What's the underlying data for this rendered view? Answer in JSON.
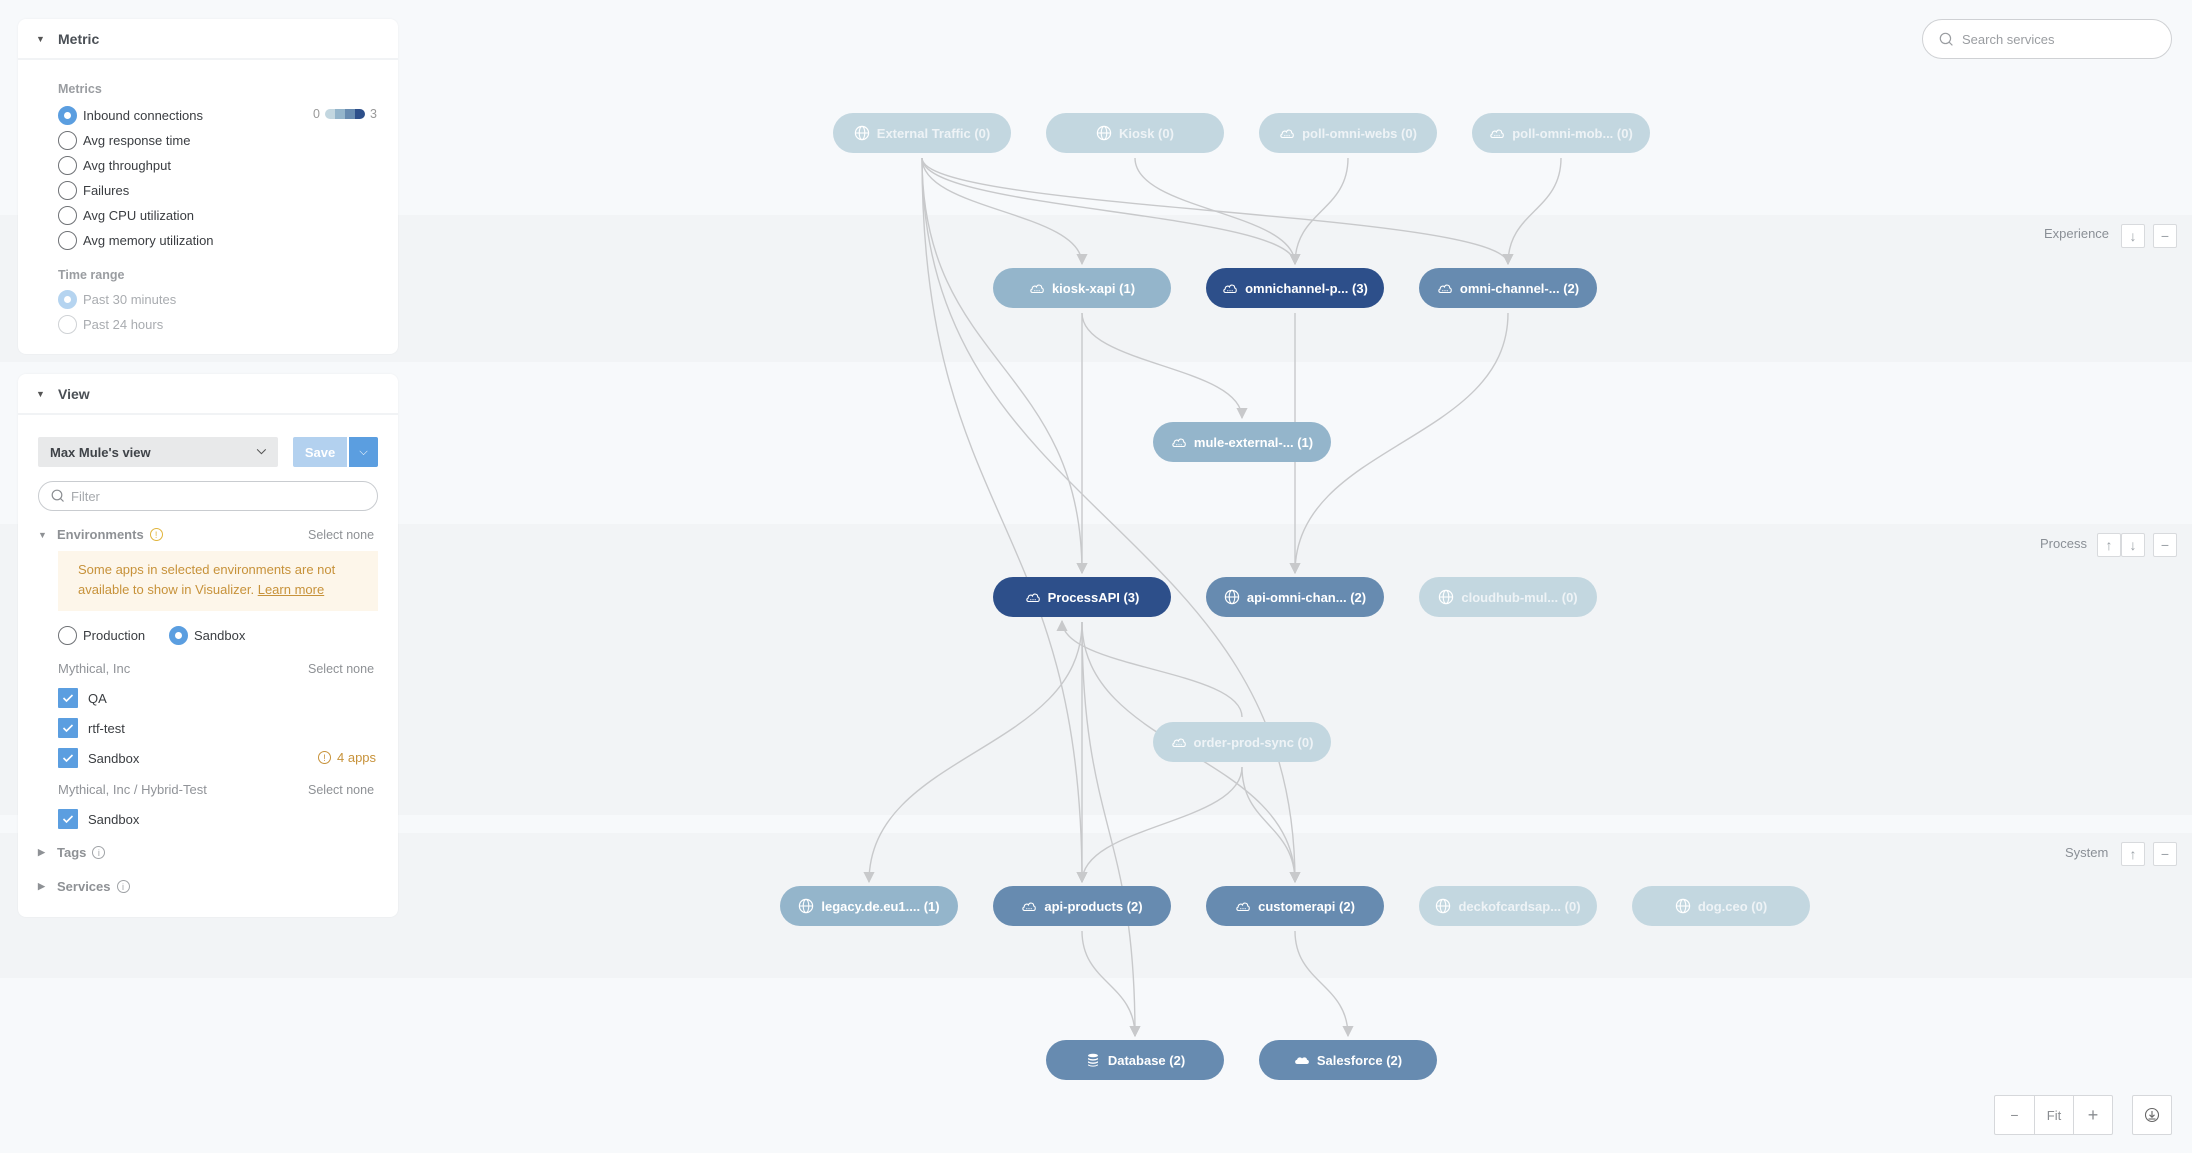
{
  "search": {
    "placeholder": "Search services"
  },
  "metric_panel": {
    "title": "Metric",
    "metrics_label": "Metrics",
    "metrics": [
      {
        "label": "Inbound connections",
        "selected": true
      },
      {
        "label": "Avg response time",
        "selected": false
      },
      {
        "label": "Avg throughput",
        "selected": false
      },
      {
        "label": "Failures",
        "selected": false
      },
      {
        "label": "Avg CPU utilization",
        "selected": false
      },
      {
        "label": "Avg memory utilization",
        "selected": false
      }
    ],
    "scale": {
      "min": "0",
      "max": "3",
      "colors": [
        "#c3d7e0",
        "#94b5cb",
        "#678bb0",
        "#2d4f8a"
      ]
    },
    "time_range_label": "Time range",
    "time_ranges": [
      {
        "label": "Past 30 minutes",
        "selected": true,
        "disabled": true
      },
      {
        "label": "Past 24 hours",
        "selected": false,
        "disabled": true
      }
    ]
  },
  "view_panel": {
    "title": "View",
    "selected_view": "Max Mule's view",
    "save_label": "Save",
    "filter_placeholder": "Filter",
    "environments": {
      "label": "Environments",
      "select_none": "Select none",
      "warning_text": "Some apps in selected environments are not available to show in Visualizer.",
      "learn_more": "Learn more",
      "types": [
        {
          "label": "Production",
          "selected": false
        },
        {
          "label": "Sandbox",
          "selected": true
        }
      ],
      "groups": [
        {
          "name": "Mythical, Inc",
          "select_none": "Select none",
          "items": [
            {
              "label": "QA",
              "checked": true
            },
            {
              "label": "rtf-test",
              "checked": true
            },
            {
              "label": "Sandbox",
              "checked": true,
              "warning": "4 apps"
            }
          ]
        },
        {
          "name": "Mythical, Inc / Hybrid-Test",
          "select_none": "Select none",
          "items": [
            {
              "label": "Sandbox",
              "checked": true
            }
          ]
        }
      ]
    },
    "tags_label": "Tags",
    "services_label": "Services"
  },
  "layers": [
    {
      "label": "Experience"
    },
    {
      "label": "Process"
    },
    {
      "label": "System"
    }
  ],
  "graph": {
    "nodes": [
      {
        "id": "ext",
        "label": "External Traffic (0)",
        "icon": "globe-icon",
        "level": 0
      },
      {
        "id": "kiosk",
        "label": "Kiosk (0)",
        "icon": "globe-icon",
        "level": 0
      },
      {
        "id": "pollweb",
        "label": "poll-omni-webs (0)",
        "icon": "cloud-icon",
        "level": 0
      },
      {
        "id": "pollmob",
        "label": "poll-omni-mob... (0)",
        "icon": "cloud-icon",
        "level": 0
      },
      {
        "id": "kxapi",
        "label": "kiosk-xapi (1)",
        "icon": "cloud-icon",
        "level": 1
      },
      {
        "id": "omnip",
        "label": "omnichannel-p... (3)",
        "icon": "cloud-icon",
        "level": 3
      },
      {
        "id": "omnic",
        "label": "omni-channel-... (2)",
        "icon": "cloud-icon",
        "level": 2
      },
      {
        "id": "mulext",
        "label": "mule-external-... (1)",
        "icon": "cloud-icon",
        "level": 1
      },
      {
        "id": "papi",
        "label": "ProcessAPI (3)",
        "icon": "cloud-icon",
        "level": 3
      },
      {
        "id": "apiomni",
        "label": "api-omni-chan... (2)",
        "icon": "globe-icon",
        "level": 2
      },
      {
        "id": "cloudhub",
        "label": "cloudhub-mul... (0)",
        "icon": "globe-icon",
        "level": 0
      },
      {
        "id": "ops",
        "label": "order-prod-sync (0)",
        "icon": "cloud-icon",
        "level": 0
      },
      {
        "id": "legacy",
        "label": "legacy.de.eu1.... (1)",
        "icon": "globe-icon",
        "level": 1
      },
      {
        "id": "apiprod",
        "label": "api-products (2)",
        "icon": "cloud-icon",
        "level": 2
      },
      {
        "id": "custapi",
        "label": "customerapi (2)",
        "icon": "cloud-icon",
        "level": 2
      },
      {
        "id": "deck",
        "label": "deckofcardsap... (0)",
        "icon": "globe-icon",
        "level": 0
      },
      {
        "id": "dog",
        "label": "dog.ceo (0)",
        "icon": "globe-icon",
        "level": 0
      },
      {
        "id": "db",
        "label": "Database (2)",
        "icon": "database-icon",
        "level": 2
      },
      {
        "id": "sf",
        "label": "Salesforce (2)",
        "icon": "salesforce-icon",
        "level": 2
      }
    ],
    "edges": [
      {
        "from": "ext",
        "to": "kxapi"
      },
      {
        "from": "ext",
        "to": "omnip"
      },
      {
        "from": "ext",
        "to": "omnic"
      },
      {
        "from": "ext",
        "to": "papi"
      },
      {
        "from": "ext",
        "to": "apiprod"
      },
      {
        "from": "ext",
        "to": "custapi"
      },
      {
        "from": "kiosk",
        "to": "omnip"
      },
      {
        "from": "pollweb",
        "to": "omnip"
      },
      {
        "from": "pollmob",
        "to": "omnic"
      },
      {
        "from": "kxapi",
        "to": "papi"
      },
      {
        "from": "kxapi",
        "to": "mulext"
      },
      {
        "from": "omnip",
        "to": "apiomni"
      },
      {
        "from": "omnic",
        "to": "apiomni"
      },
      {
        "from": "papi",
        "to": "legacy"
      },
      {
        "from": "papi",
        "to": "apiprod"
      },
      {
        "from": "papi",
        "to": "custapi"
      },
      {
        "from": "papi",
        "to": "db"
      },
      {
        "from": "ops",
        "to": "papi"
      },
      {
        "from": "ops",
        "to": "apiprod"
      },
      {
        "from": "ops",
        "to": "custapi"
      },
      {
        "from": "apiprod",
        "to": "db"
      },
      {
        "from": "custapi",
        "to": "sf"
      }
    ]
  },
  "zoom": {
    "minus": "−",
    "fit": "Fit",
    "plus": "+"
  }
}
